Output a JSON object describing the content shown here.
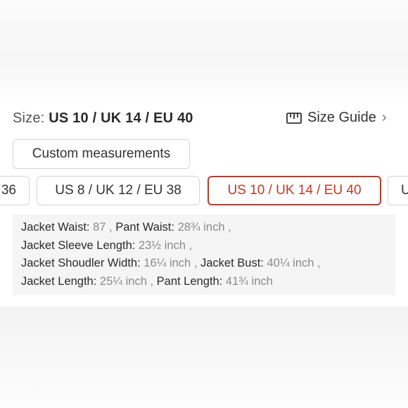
{
  "size": {
    "label": "Size:",
    "value": "US 10 / UK 14 / EU 40"
  },
  "size_guide": {
    "label": "Size Guide",
    "icon": "ruler-icon",
    "chevron": "›"
  },
  "custom_button": {
    "label": "Custom measurements"
  },
  "size_options": {
    "prev_partial": "36",
    "option1": "US 8 / UK 12 / EU 38",
    "option2_selected": "US 10 / UK 14 / EU 40",
    "next_partial": "U"
  },
  "measurements": {
    "jacket_waist": {
      "label": "Jacket Waist:",
      "value": "87"
    },
    "pant_waist": {
      "label": "Pant Waist:",
      "value": "28¾ inch"
    },
    "jacket_sleeve": {
      "label": "Jacket Sleeve Length:",
      "value": "23½ inch"
    },
    "jacket_shoulder": {
      "label": "Jacket Shoudler Width:",
      "value": "16¼ inch"
    },
    "jacket_bust": {
      "label": "Jacket Bust:",
      "value": "40¼ inch"
    },
    "jacket_length": {
      "label": "Jacket Length:",
      "value": "25¼ inch"
    },
    "pant_length": {
      "label": "Pant Length:",
      "value": "41¾ inch"
    }
  },
  "colors": {
    "selected_accent": "#c0392b",
    "border": "#d4d4d4",
    "measure_bg": "#f5f5f5"
  }
}
